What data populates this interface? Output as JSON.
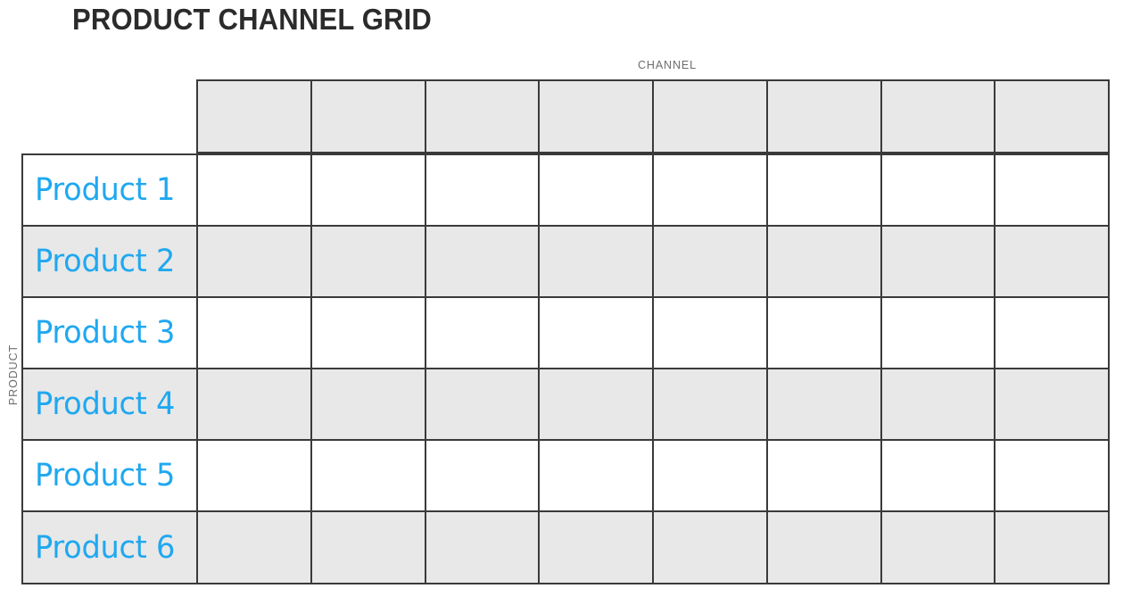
{
  "page": {
    "title": "PRODUCT CHANNEL GRID",
    "background_color": "#FFFFFF"
  },
  "axes": {
    "column_axis_label": "CHANNEL",
    "row_axis_label": "PRODUCT"
  },
  "colors": {
    "title_text": "#2B2B2B",
    "axis_label_text": "#6D6D6D",
    "row_label_text": "#1FA8F0",
    "grid_line": "#3A3A3A",
    "cell_shaded": "#E8E8E8",
    "cell_plain": "#FFFFFF"
  },
  "grid": {
    "column_count": 8,
    "row_count": 6,
    "header_cells": [
      "",
      "",
      "",
      "",
      "",
      "",
      "",
      ""
    ],
    "rows": [
      {
        "label": "Product 1",
        "shaded": false,
        "cells": [
          "",
          "",
          "",
          "",
          "",
          "",
          "",
          ""
        ]
      },
      {
        "label": "Product 2",
        "shaded": true,
        "cells": [
          "",
          "",
          "",
          "",
          "",
          "",
          "",
          ""
        ]
      },
      {
        "label": "Product 3",
        "shaded": false,
        "cells": [
          "",
          "",
          "",
          "",
          "",
          "",
          "",
          ""
        ]
      },
      {
        "label": "Product 4",
        "shaded": true,
        "cells": [
          "",
          "",
          "",
          "",
          "",
          "",
          "",
          ""
        ]
      },
      {
        "label": "Product 5",
        "shaded": false,
        "cells": [
          "",
          "",
          "",
          "",
          "",
          "",
          "",
          ""
        ]
      },
      {
        "label": "Product 6",
        "shaded": true,
        "cells": [
          "",
          "",
          "",
          "",
          "",
          "",
          "",
          ""
        ]
      }
    ]
  },
  "chart_data": {
    "type": "table",
    "title": "PRODUCT CHANNEL GRID",
    "xlabel": "CHANNEL",
    "ylabel": "PRODUCT",
    "columns": [
      "",
      "",
      "",
      "",
      "",
      "",
      "",
      ""
    ],
    "row_headers": [
      "Product 1",
      "Product 2",
      "Product 3",
      "Product 4",
      "Product 5",
      "Product 6"
    ],
    "values": [
      [
        "",
        "",
        "",
        "",
        "",
        "",
        "",
        ""
      ],
      [
        "",
        "",
        "",
        "",
        "",
        "",
        "",
        ""
      ],
      [
        "",
        "",
        "",
        "",
        "",
        "",
        "",
        ""
      ],
      [
        "",
        "",
        "",
        "",
        "",
        "",
        "",
        ""
      ],
      [
        "",
        "",
        "",
        "",
        "",
        "",
        "",
        ""
      ],
      [
        "",
        "",
        "",
        "",
        "",
        "",
        "",
        ""
      ]
    ],
    "grid": true,
    "legend": "none",
    "note": "Blank matrix template: 6 product rows by 8 channel columns, all cells empty."
  }
}
